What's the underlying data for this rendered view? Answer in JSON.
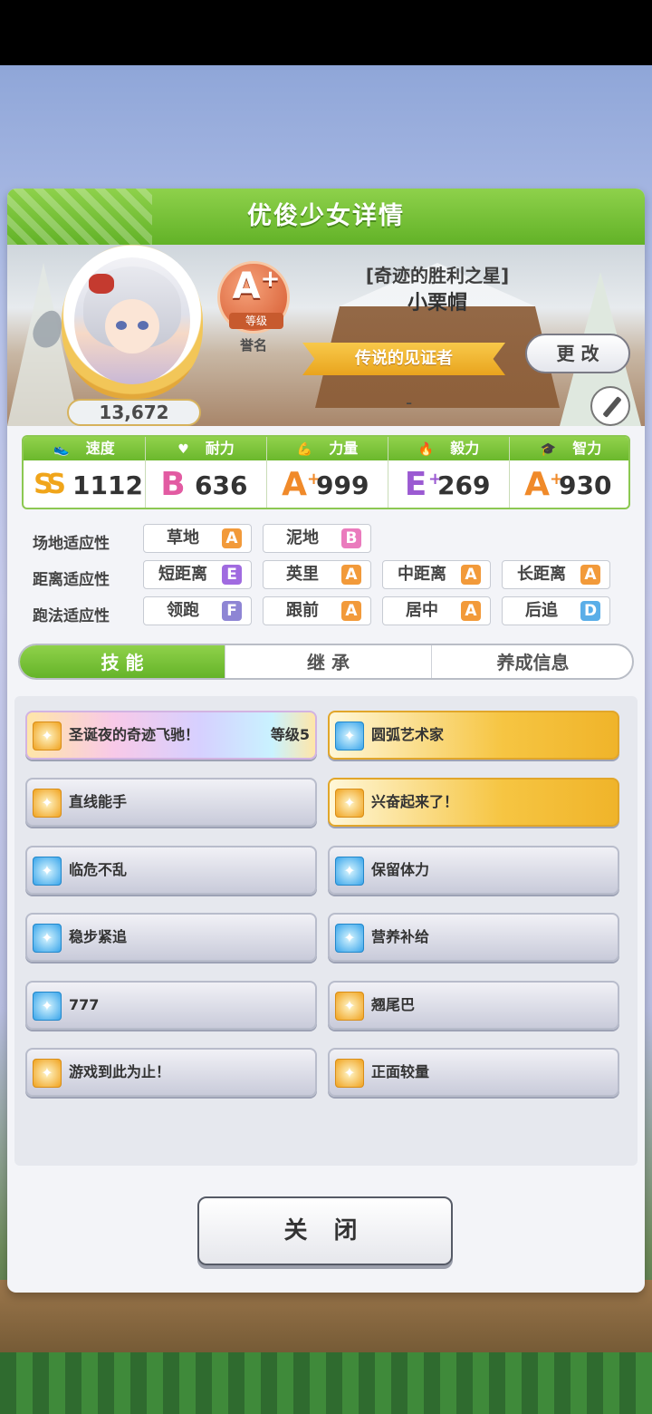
{
  "header": {
    "title": "优俊少女详情"
  },
  "profile": {
    "fans": "13,672",
    "rank": "A",
    "rank_plus": "+",
    "rank_label": "等级",
    "rank_sub": "誉名",
    "epithet": "[奇迹的胜利之星]",
    "name": "小栗帽",
    "title_ribbon": "传说的见证者",
    "change_label": "更 改",
    "subtitle": "-"
  },
  "stats": [
    {
      "label": "速度",
      "icon": "shoe-icon",
      "grade": "SS",
      "value": "1112"
    },
    {
      "label": "耐力",
      "icon": "heart-icon",
      "grade": "B",
      "value": "636"
    },
    {
      "label": "力量",
      "icon": "muscle-icon",
      "grade": "A",
      "plus": "+",
      "value": "999"
    },
    {
      "label": "毅力",
      "icon": "flame-icon",
      "grade": "E",
      "plus": "+",
      "value": "269"
    },
    {
      "label": "智力",
      "icon": "graduation-cap-icon",
      "grade": "A",
      "plus": "+",
      "value": "930"
    }
  ],
  "aptitude": {
    "track_label": "场地适应性",
    "track": [
      {
        "name": "草地",
        "grade": "A"
      },
      {
        "name": "泥地",
        "grade": "B"
      }
    ],
    "distance_label": "距离适应性",
    "distance": [
      {
        "name": "短距离",
        "grade": "E"
      },
      {
        "name": "英里",
        "grade": "A"
      },
      {
        "name": "中距离",
        "grade": "A"
      },
      {
        "name": "长距离",
        "grade": "A"
      }
    ],
    "style_label": "跑法适应性",
    "style": [
      {
        "name": "领跑",
        "grade": "F"
      },
      {
        "name": "跟前",
        "grade": "A"
      },
      {
        "name": "居中",
        "grade": "A"
      },
      {
        "name": "后追",
        "grade": "D"
      }
    ]
  },
  "tabs": [
    "技 能",
    "继 承",
    "养成信息"
  ],
  "skills": [
    {
      "name": "圣诞夜的奇迹飞驰！",
      "level": "等级5",
      "style": "rainbow",
      "icon": "yellow"
    },
    {
      "name": "圆弧艺术家",
      "style": "gold",
      "icon": "blue"
    },
    {
      "name": "直线能手",
      "style": "normal",
      "icon": "yellow"
    },
    {
      "name": "兴奋起来了！",
      "style": "gold",
      "icon": "yellow"
    },
    {
      "name": "临危不乱",
      "style": "normal",
      "icon": "blue"
    },
    {
      "name": "保留体力",
      "style": "normal",
      "icon": "blue"
    },
    {
      "name": "稳步紧追",
      "style": "normal",
      "icon": "blue"
    },
    {
      "name": "营养补给",
      "style": "normal",
      "icon": "blue"
    },
    {
      "name": "777",
      "style": "normal",
      "icon": "blue"
    },
    {
      "name": "翘尾巴",
      "style": "normal",
      "icon": "yellow"
    },
    {
      "name": "游戏到此为止！",
      "style": "normal",
      "icon": "yellow"
    },
    {
      "name": "正面较量",
      "style": "normal",
      "icon": "yellow"
    }
  ],
  "close_label": "关 闭"
}
